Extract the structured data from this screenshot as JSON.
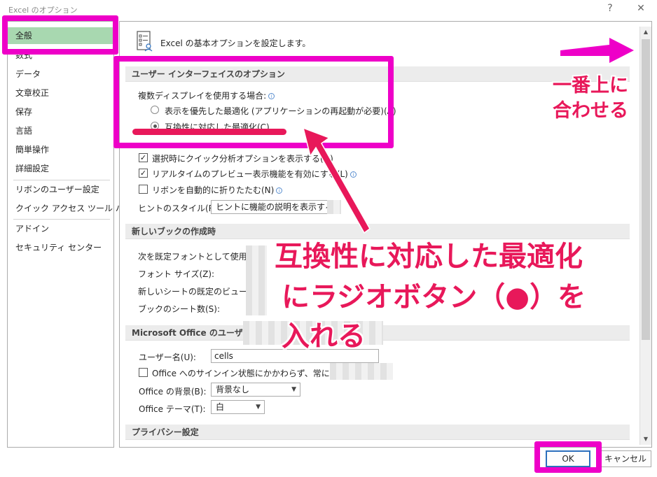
{
  "window": {
    "title": "Excel のオプション",
    "help_glyph": "?",
    "close_glyph": "✕"
  },
  "nav": {
    "items": [
      {
        "label": "全般"
      },
      {
        "label": "数式"
      },
      {
        "label": "データ"
      },
      {
        "label": "文章校正"
      },
      {
        "label": "保存"
      },
      {
        "label": "言語"
      },
      {
        "label": "簡単操作"
      },
      {
        "label": "詳細設定"
      },
      {
        "label": "リボンのユーザー設定"
      },
      {
        "label": "クイック アクセス ツール バー"
      },
      {
        "label": "アドイン"
      },
      {
        "label": "セキュリティ センター"
      }
    ],
    "selected": "全般"
  },
  "main": {
    "header": "Excel の基本オプションを設定します。",
    "ui_section": {
      "title": "ユーザー インターフェイスのオプション",
      "multi_display_label": "複数ディスプレイを使用する場合:",
      "radio_1": "表示を優先した最適化 (アプリケーションの再起動が必要)(A)",
      "radio_2": "互換性に対応した最適化(C)",
      "radio_2_selected": true,
      "check_quick_analysis": "選択時にクイック分析オプションを表示する(Q)",
      "check_quick_analysis_checked": true,
      "check_live_preview": "リアルタイムのプレビュー表示機能を有効にする(L)",
      "check_live_preview_checked": true,
      "check_collapse_ribbon": "リボンを自動的に折りたたむ(N)",
      "check_collapse_ribbon_checked": false,
      "tooltip_style_label": "ヒントのスタイル(R):",
      "tooltip_style_value": "ヒントに機能の説明を表示する"
    },
    "new_book_section": {
      "title": "新しいブックの作成時",
      "default_font_label": "次を既定フォントとして使用(N):",
      "font_size_label": "フォント サイズ(Z):",
      "default_view_label": "新しいシートの既定のビュー(V):",
      "sheet_count_label": "ブックのシート数(S):"
    },
    "office_section": {
      "title": "Microsoft Office のユーザー",
      "username_label": "ユーザー名(U):",
      "username_value": "cells",
      "signin_check_label": "Office へのサインイン状態にかかわらず、常にこれらの設",
      "signin_check_checked": false,
      "background_label": "Office の背景(B):",
      "background_value": "背景なし",
      "theme_label": "Office テーマ(T):",
      "theme_value": "白"
    },
    "privacy_section": {
      "title": "プライバシー設定"
    }
  },
  "footer": {
    "ok_label": "OK",
    "cancel_label": "キャンセル"
  },
  "annotations": {
    "top_align_line1": "一番上に",
    "top_align_line2": "合わせる",
    "instruction_line1": "互換性に対応した最適化",
    "instruction_line2": "にラジオボタン（●）を",
    "instruction_line3": "入れる",
    "highlight_color": "#ee00c8",
    "text_color": "#e8185a"
  }
}
